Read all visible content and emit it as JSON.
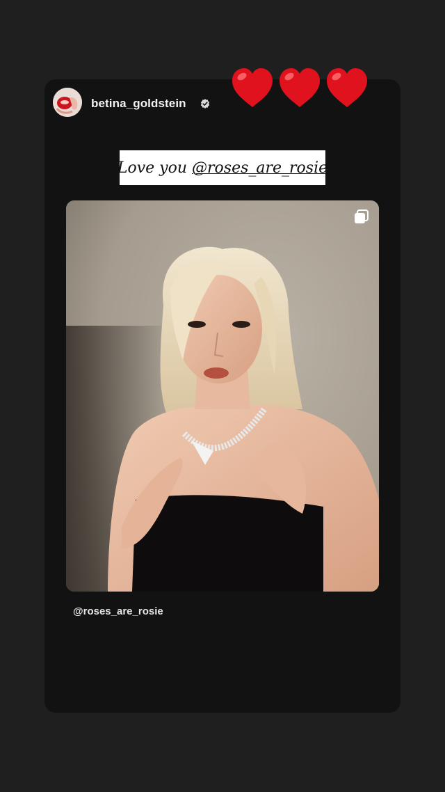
{
  "story": {
    "username": "betina_goldstein",
    "verified": true,
    "sticker_hearts": [
      "heart-icon",
      "heart-icon",
      "heart-icon"
    ],
    "caption": {
      "prefix": "Love you ",
      "mention": "@roses_are_rosie"
    },
    "shared_post": {
      "mention": "@roses_are_rosie",
      "carousel_indicator": "carousel-icon"
    }
  },
  "colors": {
    "background": "#1f1f1f",
    "card": "#121212",
    "heart": "#e0121d",
    "caption_bg": "#ffffff"
  }
}
